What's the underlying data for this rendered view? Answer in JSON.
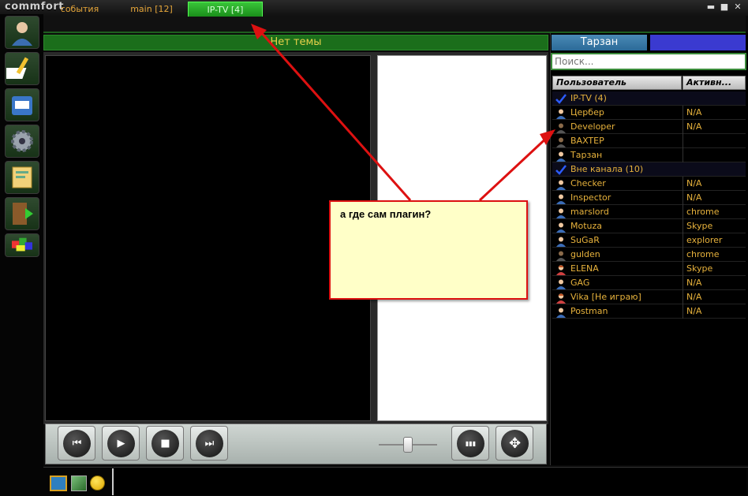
{
  "app": {
    "logo": "commfort"
  },
  "window_controls": {
    "minimize": "▬",
    "maximize": "■",
    "close": "✕"
  },
  "tabs": [
    {
      "label": "события"
    },
    {
      "label": "main [12]"
    },
    {
      "label": "IP-TV [4]"
    }
  ],
  "topic": "Нет темы",
  "right_panel": {
    "user_tab": "Тарзан",
    "search_placeholder": "Поиск...",
    "columns": [
      "Пользователь",
      "Активн..."
    ],
    "rows": [
      {
        "type": "group",
        "name": "IP-TV (4)",
        "status": ""
      },
      {
        "type": "user",
        "name": "Цербер",
        "status": "N/A",
        "icon": "user-icon"
      },
      {
        "type": "user",
        "name": "Developer",
        "status": "N/A",
        "icon": "user-dark-icon"
      },
      {
        "type": "user",
        "name": "BAXTEP",
        "status": "",
        "icon": "user-dark-icon"
      },
      {
        "type": "user",
        "name": "Тарзан",
        "status": "",
        "icon": "user-icon"
      },
      {
        "type": "group",
        "name": "Вне канала (10)",
        "status": ""
      },
      {
        "type": "user",
        "name": "Checker",
        "status": "N/A",
        "icon": "user-icon"
      },
      {
        "type": "user",
        "name": "Inspector",
        "status": "N/A",
        "icon": "user-icon"
      },
      {
        "type": "user",
        "name": "marslord",
        "status": "chrome",
        "icon": "user-icon"
      },
      {
        "type": "user",
        "name": "Motuza",
        "status": "Skype",
        "icon": "user-icon"
      },
      {
        "type": "user",
        "name": "SuGaR",
        "status": "explorer",
        "icon": "user-icon"
      },
      {
        "type": "user",
        "name": "gulden",
        "status": "chrome",
        "icon": "user-dark-icon"
      },
      {
        "type": "user",
        "name": "ELENA",
        "status": "Skype",
        "icon": "user-female-icon"
      },
      {
        "type": "user",
        "name": "GAG",
        "status": "N/A",
        "icon": "user-icon"
      },
      {
        "type": "user",
        "name": "Vika [Не играю]",
        "status": "N/A",
        "icon": "user-female-icon"
      },
      {
        "type": "user",
        "name": "Postman",
        "status": "N/A",
        "icon": "user-icon"
      }
    ]
  },
  "player": {
    "buttons": [
      {
        "name": "previous-button",
        "glyph": "⏮"
      },
      {
        "name": "play-button",
        "glyph": "▶"
      },
      {
        "name": "stop-button",
        "glyph": "■"
      },
      {
        "name": "next-button",
        "glyph": "⏭"
      },
      {
        "name": "equalizer-button",
        "glyph": "▮▮▮"
      },
      {
        "name": "fullscreen-button",
        "glyph": "✥"
      }
    ],
    "volume": 0.5
  },
  "annotation": {
    "text": "а где сам плагин?"
  },
  "colors": {
    "accent_green": "#1b6e1b",
    "text_orange": "#e7b23c",
    "annotation_red": "#dd1111"
  }
}
